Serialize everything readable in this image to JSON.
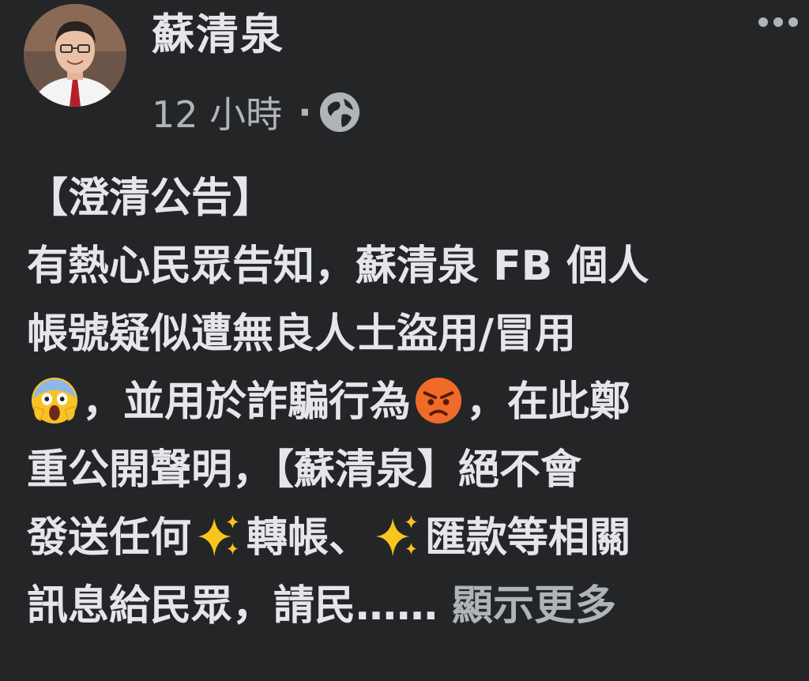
{
  "post": {
    "author": "蘇清泉",
    "time": "12 小時",
    "separator": "·",
    "privacy_icon": "globe-icon",
    "more_icon": "more-options-icon"
  },
  "content": {
    "l1": "【澄清公告】",
    "l2": "有熱心民眾告知，蘇清泉 FB 個人",
    "l3": "帳號疑似遭無良人士盜用/冒用",
    "l4a": "，並用於詐騙行為",
    "l4b": "，在此鄭",
    "l5": "重公開聲明，【蘇清泉】絕不會",
    "l6a": "發送任何",
    "l6b": "轉帳、",
    "l6c": "匯款等相關",
    "l7": "訊息給民眾，請民……",
    "see_more": "顯示更多",
    "emojis": [
      "screaming-face-emoji",
      "angry-face-emoji",
      "sparkles-emoji"
    ]
  }
}
